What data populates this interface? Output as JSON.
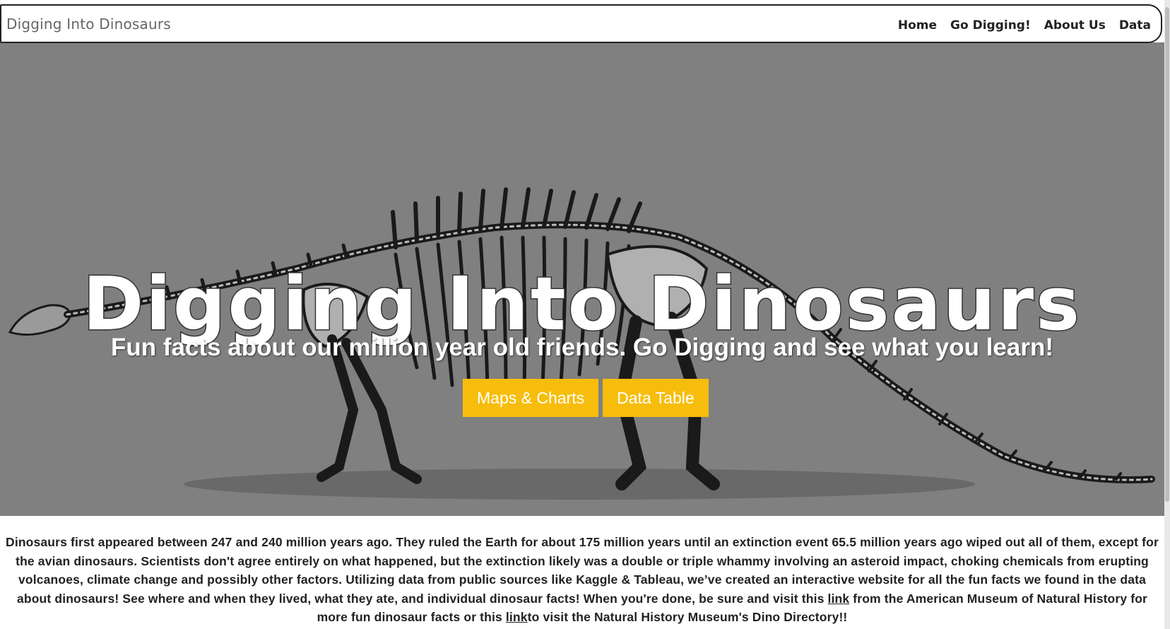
{
  "navbar": {
    "brand": "Digging Into Dinosaurs",
    "links": [
      "Home",
      "Go Digging!",
      "About Us",
      "Data"
    ]
  },
  "hero": {
    "title": "Digging Into Dinosaurs",
    "subtitle": "Fun facts about our million year old friends. Go Digging and see what you learn!",
    "buttons": [
      "Maps & Charts",
      "Data Table"
    ],
    "background_color": "#808080",
    "button_color": "#f7bd0c",
    "image": "dinosaur-skeleton-illustration"
  },
  "description": {
    "part1": "Dinosaurs first appeared between 247 and 240 million years ago. They ruled the Earth for about 175 million years until an extinction event 65.5 million years ago wiped out all of them, except for the avian dinosaurs. Scientists don't agree entirely on what happened, but the extinction likely was a double or triple whammy involving an asteroid impact, choking chemicals from erupting volcanoes, climate change and possibly other factors. Utilizing data from public sources like Kaggle & Tableau, we’ve created an interactive website for all the fun facts we found in the data about dinosaurs! See where and when they lived, what they ate, and individual dinosaur facts! When you're done, be sure and visit this ",
    "link1": "link",
    "part2": " from the American Museum of Natural History for more fun dinosaur facts or this ",
    "link2": "link",
    "part3": "to visit the Natural History Museum's Dino Directory!!"
  }
}
